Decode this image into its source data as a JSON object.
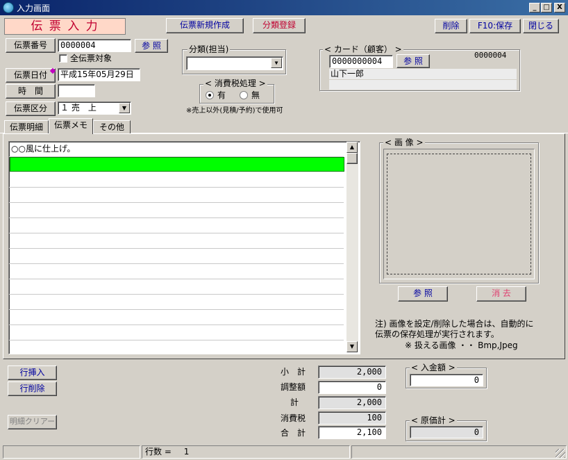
{
  "window": {
    "title": "入力画面",
    "minimize": "_",
    "maximize": "□",
    "close": "X"
  },
  "header": {
    "form_title": "伝 票 入 力",
    "new_slip": "伝票新規作成",
    "category_register": "分類登録",
    "delete": "削除",
    "save": "F10:保存",
    "close": "閉じる"
  },
  "left": {
    "slip_number_label": "伝票番号",
    "slip_number": "0000004",
    "ref_button": "参 照",
    "all_slips_label": "全伝票対象",
    "slip_date_label": "伝票日付",
    "slip_date": "平成15年05月29日",
    "time_label": "時　間",
    "time_value": "",
    "slip_type_label": "伝票区分",
    "slip_type": "１ 売　上"
  },
  "category": {
    "title": "分類(担当)",
    "selected": ""
  },
  "tax": {
    "title": "< 消費税処理 >",
    "option_yes": "有",
    "option_no": "無",
    "note": "※売上以外(見積/予約)で使用可"
  },
  "card": {
    "title": "< カード（顧客） >",
    "card_number": "0000000004",
    "ref_button": "参 照",
    "customer_code": "0000004",
    "customer_name": "山下一郎"
  },
  "tabs": [
    {
      "label": "伝票明細"
    },
    {
      "label": "伝票メモ"
    },
    {
      "label": "その他"
    }
  ],
  "memo": {
    "lines": [
      "○○風に仕上げ。"
    ]
  },
  "image": {
    "title": "< 画 像 >",
    "ref_button": "参 照",
    "clear_button": "消 去",
    "note1": "注) 画像を設定/削除した場合は、自動的に",
    "note2": "伝票の保存処理が実行されます。",
    "note3": "※ 扱える画像 ・・ Bmp,Jpeg"
  },
  "actions": {
    "insert_row": "行挿入",
    "delete_row": "行削除",
    "clear_detail": "明細クリアー"
  },
  "totals": {
    "subtotal_label": "小　計",
    "subtotal": "2,000",
    "adjust_label": "調整額",
    "adjust": "0",
    "total_label": "計",
    "total": "2,000",
    "tax_label": "消費税",
    "tax": "100",
    "grand_label": "合　計",
    "grand": "2,100"
  },
  "deposit": {
    "title": "< 入金額 >",
    "value": "0"
  },
  "cost": {
    "title": "< 原価計 >",
    "value": "0"
  },
  "status": {
    "rows_label": "行数 =",
    "rows_value": "1"
  }
}
